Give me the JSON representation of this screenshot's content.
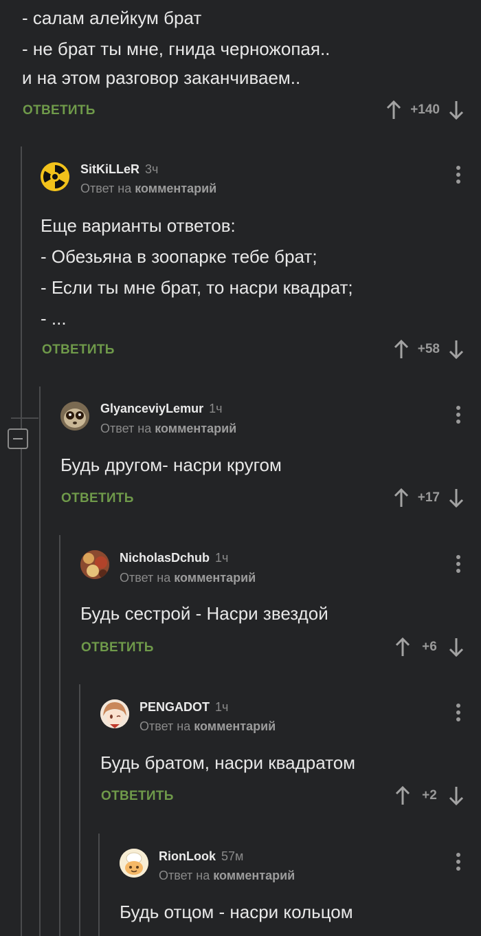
{
  "top_comment": {
    "lines": [
      "- салам алейкум брат",
      "- не брат ты мне, гнида черножопая..",
      "и на этом разговор заканчиваем.."
    ],
    "reply_label": "ОТВЕТИТЬ",
    "score": "+140"
  },
  "comments": [
    {
      "username": "SitKiLLeR",
      "time": "3ч",
      "reply_to_prefix": "Ответ на",
      "reply_to_link": "комментарий",
      "lines": [
        "Еще варианты ответов:",
        "- Обезьяна в зоопарке тебе брат;",
        "- Если ты мне брат, то насри квадрат;",
        "- ..."
      ],
      "reply_label": "ОТВЕТИТЬ",
      "score": "+58"
    },
    {
      "username": "GlyanceviyLemur",
      "time": "1ч",
      "reply_to_prefix": "Ответ на",
      "reply_to_link": "комментарий",
      "lines": [
        "Будь другом- насри кругом"
      ],
      "reply_label": "ОТВЕТИТЬ",
      "score": "+17"
    },
    {
      "username": "NicholasDchub",
      "time": "1ч",
      "reply_to_prefix": "Ответ на",
      "reply_to_link": "комментарий",
      "lines": [
        "Будь сестрой - Насри звездой"
      ],
      "reply_label": "ОТВЕТИТЬ",
      "score": "+6"
    },
    {
      "username": "PENGADOT",
      "time": "1ч",
      "reply_to_prefix": "Ответ на",
      "reply_to_link": "комментарий",
      "lines": [
        "Будь братом, насри квадратом"
      ],
      "reply_label": "ОТВЕТИТЬ",
      "score": "+2"
    },
    {
      "username": "RionLook",
      "time": "57м",
      "reply_to_prefix": "Ответ на",
      "reply_to_link": "комментарий",
      "lines": [
        "Будь отцом - насри кольцом"
      ]
    }
  ],
  "colors": {
    "background": "#232426",
    "accent": "#6f9a4a",
    "thread_line": "#4a4b4d"
  }
}
